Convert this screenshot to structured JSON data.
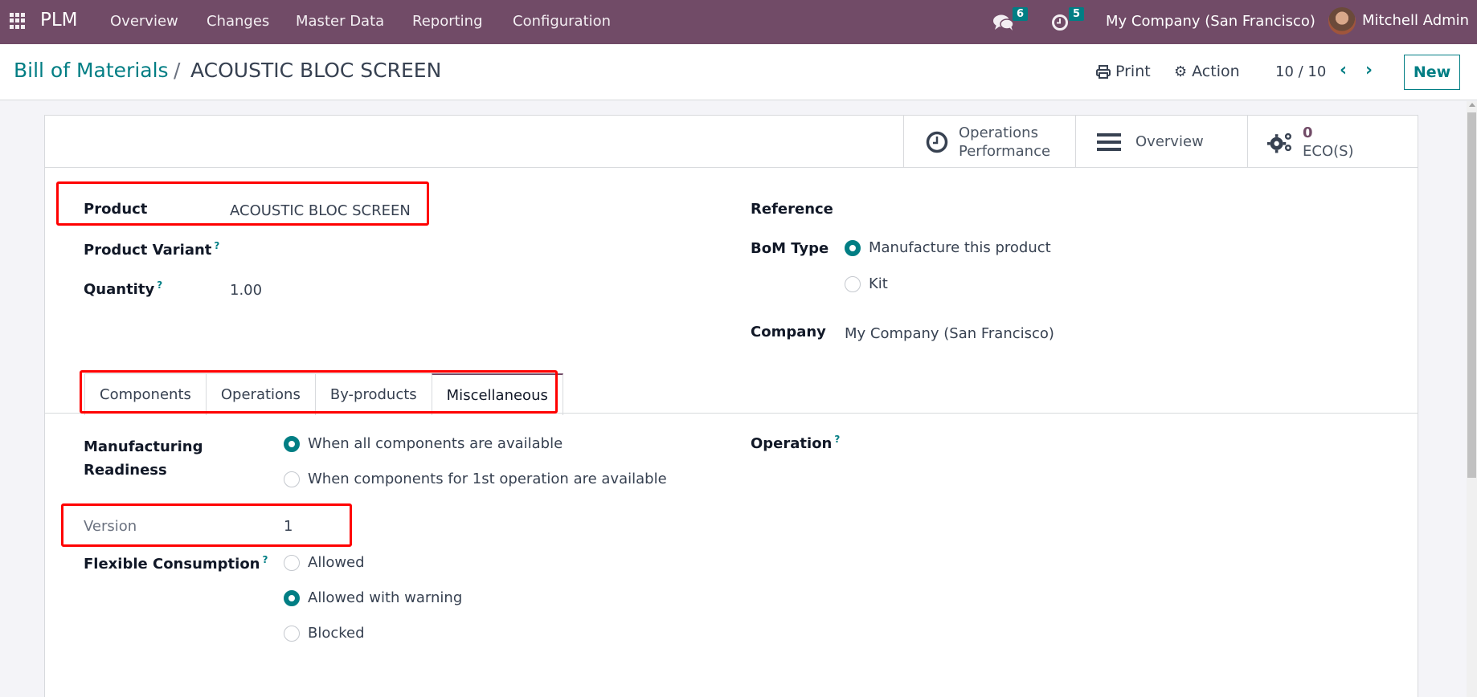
{
  "navbar": {
    "app_name": "PLM",
    "menu": [
      "Overview",
      "Changes",
      "Master Data",
      "Reporting",
      "Configuration"
    ],
    "messages_badge": "6",
    "activities_badge": "5",
    "company": "My Company (San Francisco)",
    "user": "Mitchell Admin",
    "badge_color": "#017e84",
    "bar_color": "#714b67"
  },
  "control_panel": {
    "breadcrumb_parent": "Bill of Materials",
    "breadcrumb_separator": "/",
    "breadcrumb_current": "ACOUSTIC BLOC SCREEN",
    "print_label": "Print",
    "action_label": "Action",
    "pager": "10 / 10",
    "new_label": "New"
  },
  "smart_buttons": [
    {
      "icon": "clock-icon",
      "line1": "Operations",
      "line2": "Performance"
    },
    {
      "icon": "bars-icon",
      "line1": "Overview"
    },
    {
      "icon": "cogs-icon",
      "value": "0",
      "line2": "ECO(S)"
    }
  ],
  "form": {
    "product_label": "Product",
    "product_value": "ACOUSTIC BLOC SCREEN",
    "product_variant_label": "Product Variant",
    "product_variant_value": "",
    "quantity_label": "Quantity",
    "quantity_value": "1.00",
    "reference_label": "Reference",
    "reference_value": "",
    "bom_type_label": "BoM Type",
    "bom_type_options": [
      {
        "label": "Manufacture this product",
        "checked": true
      },
      {
        "label": "Kit",
        "checked": false
      }
    ],
    "company_label": "Company",
    "company_value": "My Company (San Francisco)",
    "help_mark": "?"
  },
  "tabs": [
    {
      "label": "Components",
      "active": false
    },
    {
      "label": "Operations",
      "active": false
    },
    {
      "label": "By-products",
      "active": false
    },
    {
      "label": "Miscellaneous",
      "active": true
    }
  ],
  "misc": {
    "readiness_label_1": "Manufacturing",
    "readiness_label_2": "Readiness",
    "readiness_options": [
      {
        "label": "When all components are available",
        "checked": true
      },
      {
        "label": "When components for 1st operation are available",
        "checked": false
      }
    ],
    "operation_label": "Operation",
    "version_label": "Version",
    "version_value": "1",
    "flexible_label": "Flexible Consumption",
    "flexible_options": [
      {
        "label": "Allowed",
        "checked": false
      },
      {
        "label": "Allowed with warning",
        "checked": true
      },
      {
        "label": "Blocked",
        "checked": false
      }
    ]
  },
  "annotation_color": "#ff0000"
}
